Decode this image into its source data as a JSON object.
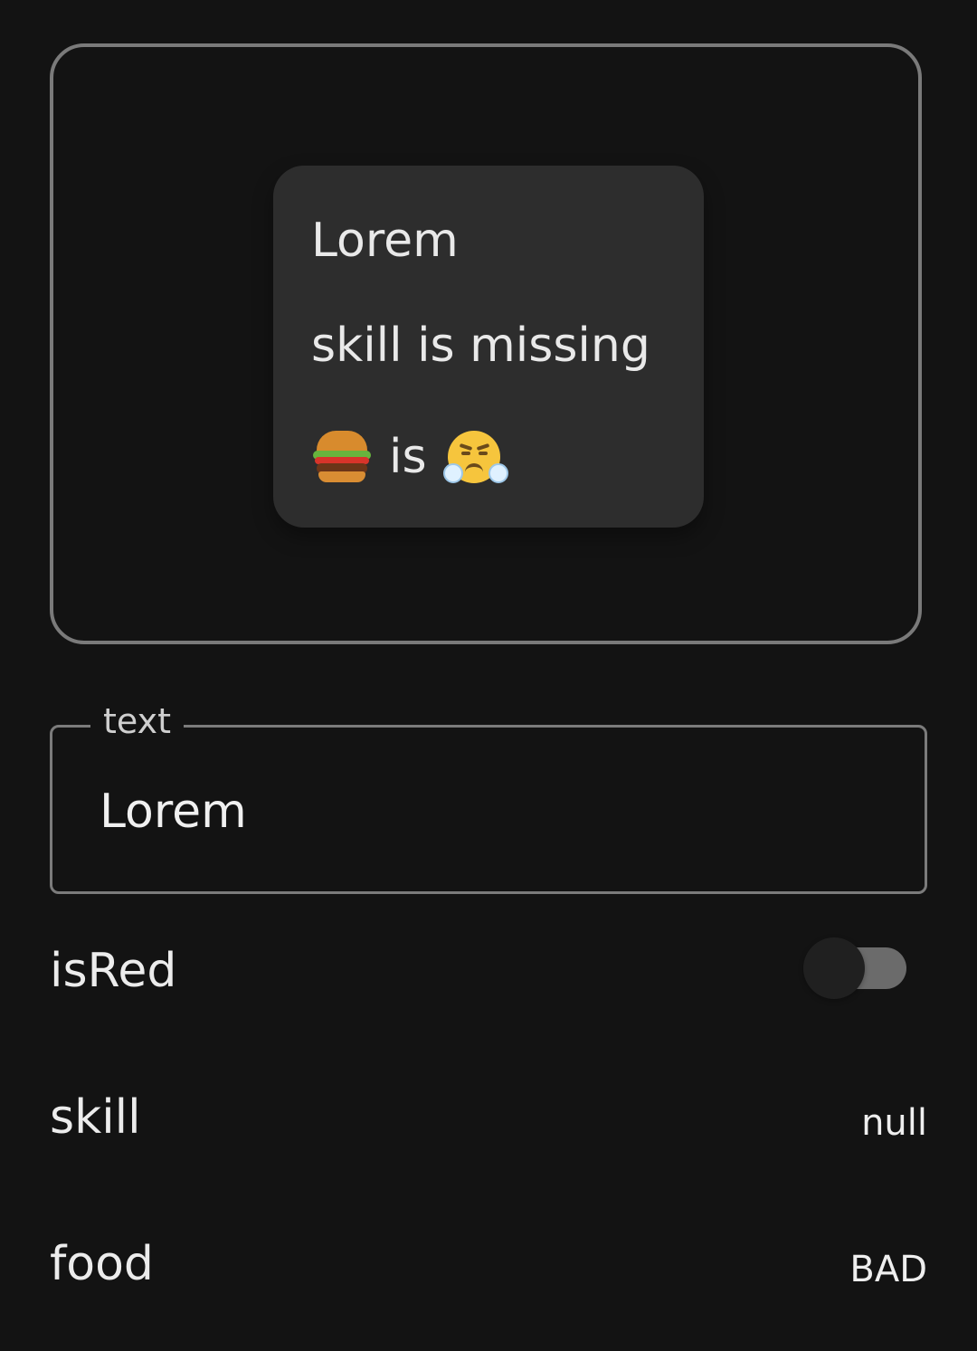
{
  "preview": {
    "text": "Lorem",
    "skill_message": "skill is missing",
    "food_connector": "is",
    "food_icon": "burger-icon",
    "mood_icon": "angry-face-icon"
  },
  "form": {
    "text_label": "text",
    "text_value": "Lorem",
    "isred_label": "isRed",
    "skill_label": "skill",
    "skill_value": "null",
    "food_label": "food",
    "food_value": "BAD"
  },
  "toggle": {
    "state": "off"
  }
}
